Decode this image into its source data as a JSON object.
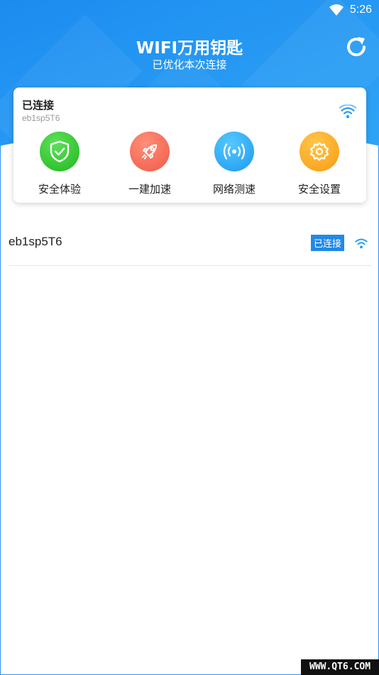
{
  "status_bar": {
    "time": "5:26",
    "wifi_icon": "wifi-icon"
  },
  "header": {
    "title": "WIFI万用钥匙",
    "subtitle": "已优化本次连接",
    "refresh_icon": "refresh-icon"
  },
  "card": {
    "status": "已连接",
    "ssid": "eb1sp5T6",
    "actions": [
      {
        "label": "安全体验",
        "icon": "shield-check-icon",
        "color": "#1fb81f"
      },
      {
        "label": "一建加速",
        "icon": "rocket-icon",
        "color": "#f05a48"
      },
      {
        "label": "网络测速",
        "icon": "signal-broadcast-icon",
        "color": "#1d9af0"
      },
      {
        "label": "安全设置",
        "icon": "gear-icon",
        "color": "#f99a12"
      }
    ]
  },
  "networks": [
    {
      "ssid": "eb1sp5T6",
      "badge": "已连接"
    }
  ],
  "watermark": "WWW.QT6.COM",
  "colors": {
    "primary": "#2189e6",
    "header_start": "#1e8ff2",
    "header_end": "#2aa0f5"
  }
}
